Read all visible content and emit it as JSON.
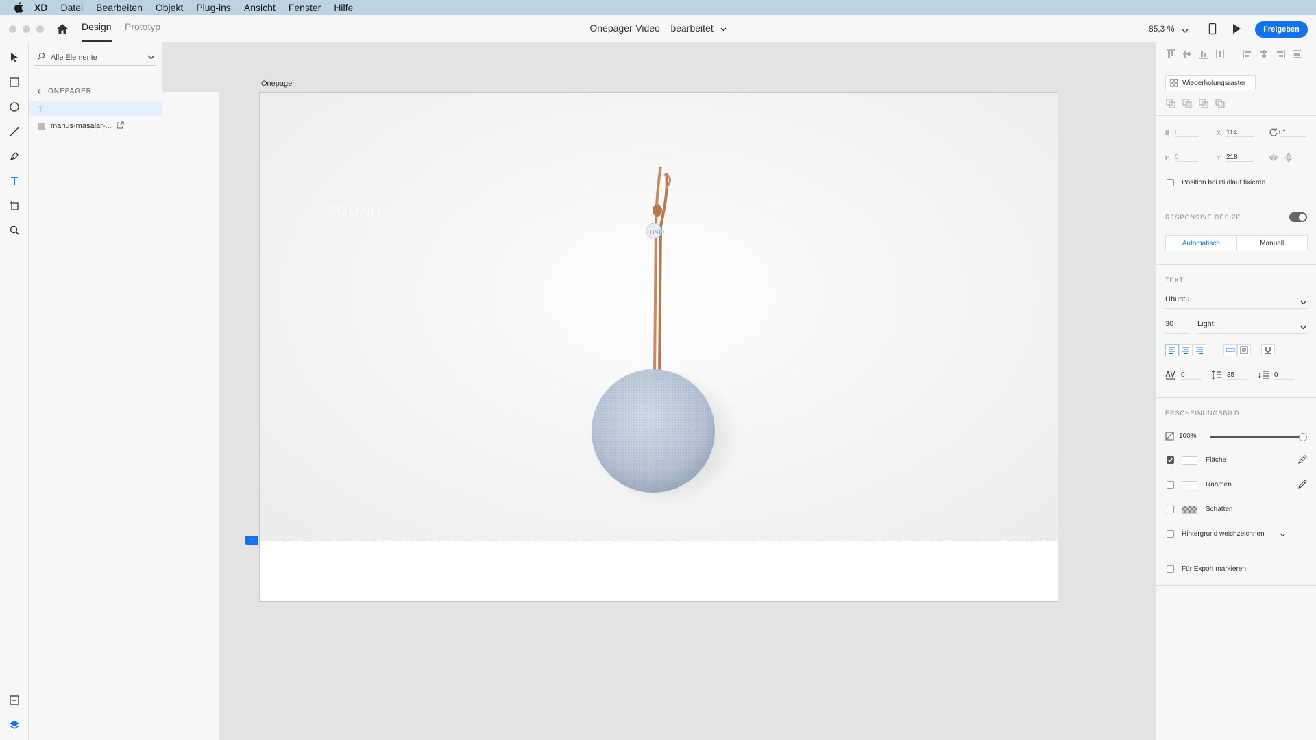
{
  "menubar": {
    "app": "XD",
    "items": [
      "Datei",
      "Bearbeiten",
      "Objekt",
      "Plug-ins",
      "Ansicht",
      "Fenster",
      "Hilfe"
    ]
  },
  "titlebar": {
    "tabs": [
      "Design",
      "Prototyp"
    ],
    "document_title": "Onepager-Video – bearbeitet",
    "zoom": "85,3 %",
    "share_label": "Freigeben"
  },
  "layers": {
    "search_placeholder": "Alle Elemente",
    "breadcrumb": "ONEPAGER",
    "text_layer_glyph": "T",
    "image_layer_name": "marius-masalar-..."
  },
  "canvas": {
    "artboard_name": "Onepager",
    "headline": "SOUND",
    "guide_handle_glyph": "="
  },
  "properties": {
    "repeat_grid_label": "Wiederholungsraster",
    "width_label": "B",
    "width_value": "0",
    "height_label": "H",
    "height_value": "0",
    "x_label": "X",
    "x_value": "114",
    "y_label": "Y",
    "y_value": "218",
    "rotation_value": "0°",
    "fix_position_label": "Position bei Bildlauf fixieren",
    "responsive_resize_label": "RESPONSIVE RESIZE",
    "responsive_resize_on": true,
    "resize_modes": [
      "Automatisch",
      "Manuell"
    ],
    "text_section_label": "TEXT",
    "font_family": "Ubuntu",
    "font_size": "30",
    "font_weight": "Light",
    "char_spacing": "0",
    "line_spacing": "35",
    "paragraph_spacing": "0",
    "appearance_section_label": "ERSCHEINUNGSBILD",
    "opacity": "100%",
    "fill_label": "Fläche",
    "fill_checked": true,
    "border_label": "Rahmen",
    "border_checked": false,
    "shadow_label": "Schatten",
    "shadow_checked": false,
    "blur_label": "Hintergrund weichzeichnen",
    "blur_checked": false,
    "export_label": "Für Export markieren",
    "export_checked": false
  },
  "colors": {
    "accent": "#1473e6",
    "guide": "#1a9be0",
    "strap": "#c98a63",
    "speaker": "#b8c4d6"
  }
}
